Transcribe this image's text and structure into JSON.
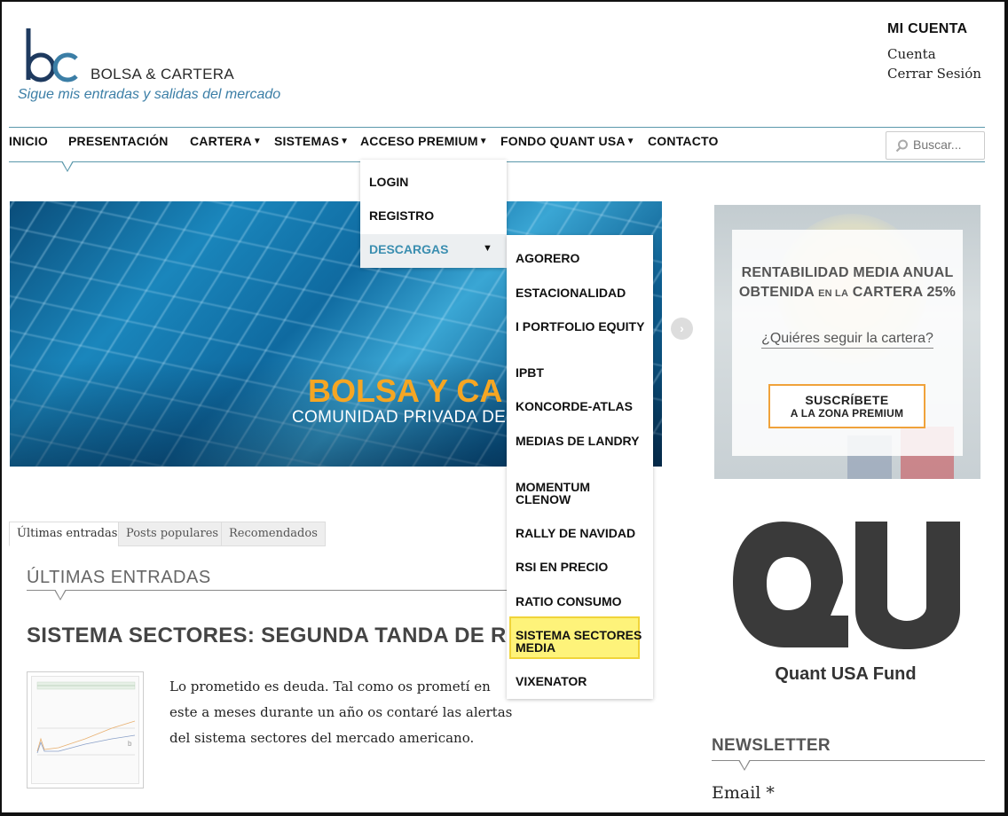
{
  "site": {
    "logo_text": "BOLSA & CARTERA",
    "tagline": "Sigue mis entradas y salidas del mercado",
    "brand_color": "#1e3a5f",
    "accent_color": "#3b7ea6"
  },
  "account": {
    "title": "MI CUENTA",
    "links": [
      "Cuenta",
      "Cerrar Sesión"
    ]
  },
  "nav": {
    "items": [
      {
        "label": "INICIO",
        "has_submenu": false
      },
      {
        "label": "PRESENTACIÓN",
        "has_submenu": false
      },
      {
        "label": "CARTERA",
        "has_submenu": true
      },
      {
        "label": "SISTEMAS",
        "has_submenu": true
      },
      {
        "label": "ACCESO PREMIUM",
        "has_submenu": true
      },
      {
        "label": "FONDO QUANT USA",
        "has_submenu": true
      },
      {
        "label": "CONTACTO",
        "has_submenu": false
      }
    ],
    "submenu_arrow": "▼",
    "search_placeholder": "Buscar..."
  },
  "dropdown_premium": {
    "items": [
      "LOGIN",
      "REGISTRO",
      "DESCARGAS"
    ],
    "active_item": "DESCARGAS",
    "sub_arrow": "▼"
  },
  "dropdown_descargas": {
    "items": [
      "AGORERO",
      "ESTACIONALIDAD",
      "I PORTFOLIO EQUITY",
      "IPBT",
      "KONCORDE-ATLAS",
      "MEDIAS DE LANDRY",
      "MOMENTUM CLENOW",
      "RALLY DE NAVIDAD",
      "RSI EN PRECIO",
      "RATIO CONSUMO",
      "SISTEMA SECTORES MEDIA",
      "VIXENATOR"
    ],
    "highlighted_item": "SISTEMA SECTORES MEDIA",
    "highlight_color": "#fef37a"
  },
  "slider": {
    "title": "BOLSA Y CA",
    "subtitle": "COMUNIDAD PRIVADA DE",
    "next_icon": "›",
    "title_color": "#f5a623"
  },
  "tabs": [
    "Últimas entradas",
    "Posts populares",
    "Recomendados"
  ],
  "active_tab": "Últimas entradas",
  "latest": {
    "section_title": "ÚLTIMAS ENTRADAS",
    "post_title": "SISTEMA SECTORES: SEGUNDA TANDA DE R",
    "excerpt": "Lo prometido es deuda. Tal como os prometí en este a meses durante un año os contaré las alertas del sistema sectores del mercado americano."
  },
  "promo": {
    "line1": "RENTABILIDAD MEDIA ANUAL",
    "line2_a": "OBTENIDA",
    "line2_b": "EN LA",
    "line2_c": "CARTERA 25%",
    "question": "¿Quiéres seguir la cartera?",
    "button_line1": "SUSCRÍBETE",
    "button_line2": "A LA ZONA PREMIUM",
    "button_border_color": "#f0a23a"
  },
  "quant_fund": {
    "logo_letters": "QU",
    "caption": "Quant USA Fund"
  },
  "newsletter": {
    "title": "NEWSLETTER",
    "email_label": "Email *"
  }
}
